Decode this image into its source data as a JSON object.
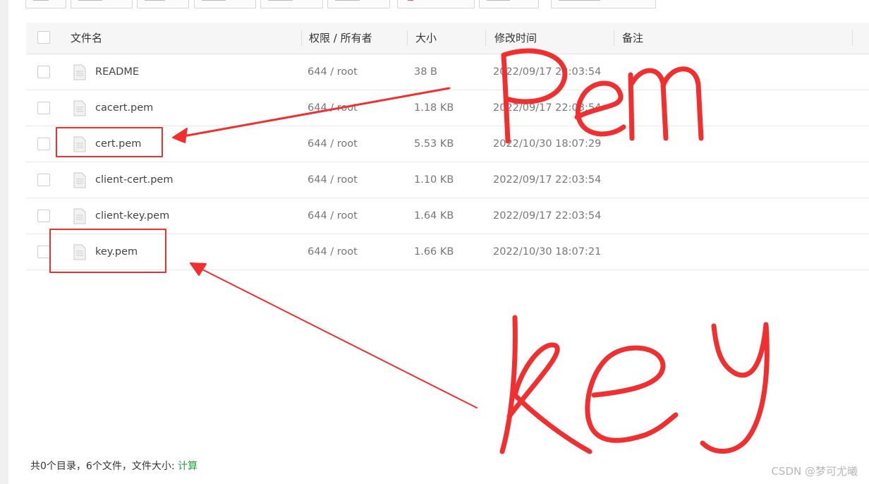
{
  "table": {
    "headers": {
      "name": "文件名",
      "perm": "权限 / 所有者",
      "size": "大小",
      "mtime": "修改时间",
      "note": "备注"
    },
    "rows": [
      {
        "name": "README",
        "perm": "644 / root",
        "size": "38 B",
        "mtime": "2022/09/17 22:03:54"
      },
      {
        "name": "cacert.pem",
        "perm": "644 / root",
        "size": "1.18 KB",
        "mtime": "2022/09/17 22:03:54"
      },
      {
        "name": "cert.pem",
        "perm": "644 / root",
        "size": "5.53 KB",
        "mtime": "2022/10/30 18:07:29"
      },
      {
        "name": "client-cert.pem",
        "perm": "644 / root",
        "size": "1.10 KB",
        "mtime": "2022/09/17 22:03:54"
      },
      {
        "name": "client-key.pem",
        "perm": "644 / root",
        "size": "1.64 KB",
        "mtime": "2022/09/17 22:03:54"
      },
      {
        "name": "key.pem",
        "perm": "644 / root",
        "size": "1.66 KB",
        "mtime": "2022/10/30 18:07:21"
      }
    ]
  },
  "footer": {
    "summary": "共0个目录，6个文件，文件大小: ",
    "calc_link": "计算"
  },
  "annotations": {
    "pem_label": "Pem",
    "key_label": "key",
    "color": "#f03030"
  },
  "watermark": "CSDN @梦可尤曦"
}
